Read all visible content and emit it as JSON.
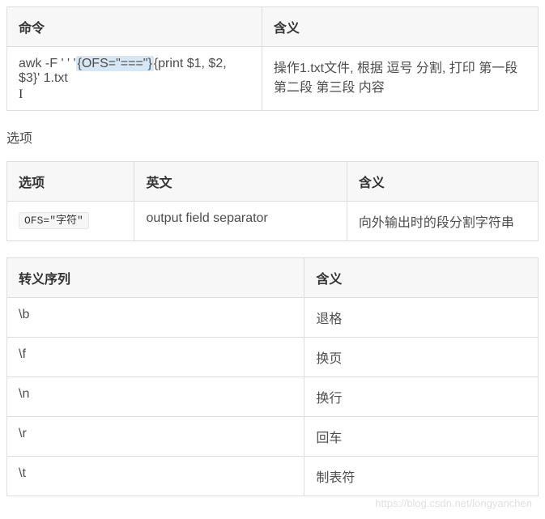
{
  "table1": {
    "headers": [
      "命令",
      "含义"
    ],
    "row": {
      "cmd_prefix": "awk   -F ' '   '",
      "cmd_highlight": "{OFS=\"===\"}",
      "cmd_suffix": "{print $1, $2, $3}' 1.txt",
      "meaning": "操作1.txt文件, 根据 逗号 分割, 打印 第一段 第二段 第三段 内容"
    }
  },
  "section_options": "选项",
  "table2": {
    "headers": [
      "选项",
      "英文",
      "含义"
    ],
    "row": {
      "option_code": "OFS=\"字符\"",
      "english": "output field separator",
      "meaning": "向外输出时的段分割字符串"
    }
  },
  "table3": {
    "headers": [
      "转义序列",
      "含义"
    ],
    "rows": [
      {
        "seq": "\\b",
        "meaning": "退格"
      },
      {
        "seq": "\\f",
        "meaning": "换页"
      },
      {
        "seq": "\\n",
        "meaning": "换行"
      },
      {
        "seq": "\\r",
        "meaning": "回车"
      },
      {
        "seq": "\\t",
        "meaning": "制表符"
      }
    ]
  },
  "cursor_glyph": "I",
  "watermark": "https://blog.csdn.net/longyanchen"
}
